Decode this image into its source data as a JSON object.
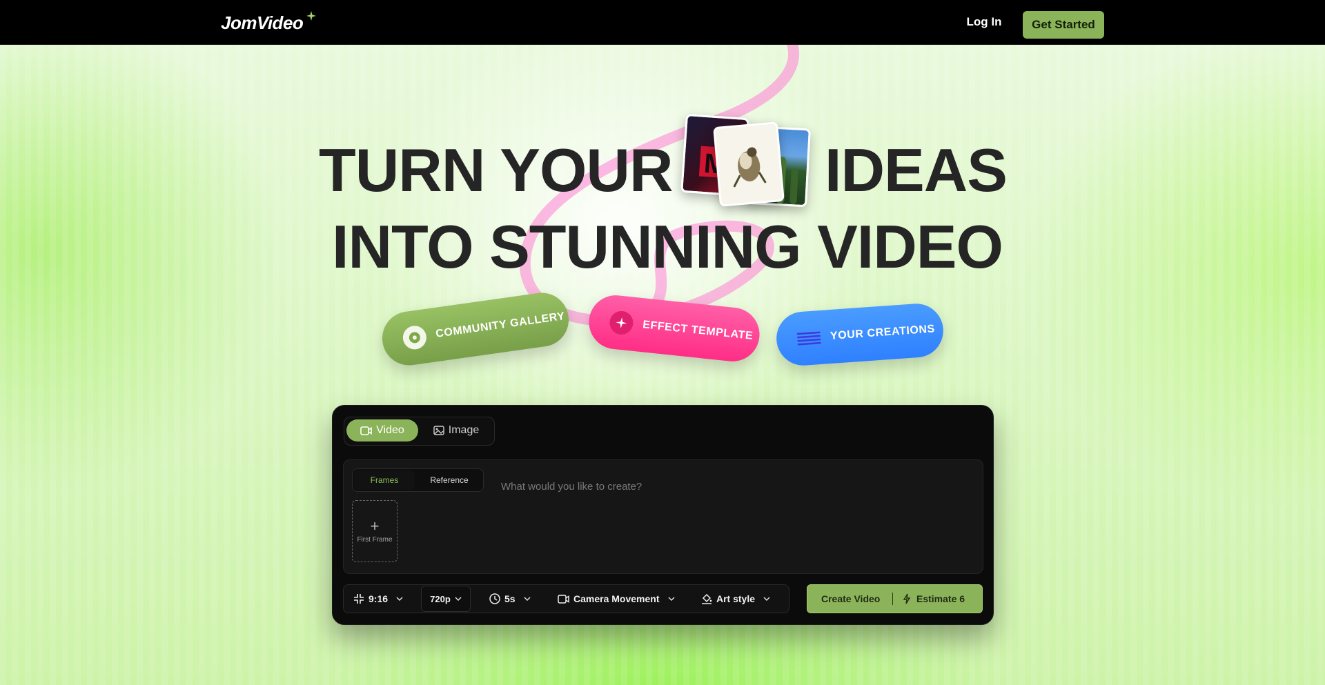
{
  "header": {
    "logo_text": "JomVideo",
    "login_label": "Log In",
    "get_started_label": "Get Started"
  },
  "hero": {
    "line1_left": "TURN YOUR",
    "line1_right": "IDEAS",
    "line2": "INTO STUNNING VIDEO"
  },
  "pills": {
    "community_gallery": "COMMUNITY GALLERY",
    "effect_template": "EFFECT TEMPLATE",
    "your_creations": "YOUR CREATIONS"
  },
  "creator": {
    "mode_tabs": {
      "video": "Video",
      "image": "Image",
      "active": "video"
    },
    "sub_tabs": {
      "frames": "Frames",
      "reference": "Reference",
      "active": "frames"
    },
    "prompt_placeholder": "What would you like to create?",
    "prompt_value": "",
    "first_frame_label": "First Frame",
    "options": {
      "aspect_ratio": "9:16",
      "resolution": "720p",
      "duration": "5s",
      "camera_movement": "Camera Movement",
      "art_style": "Art style"
    },
    "create_label": "Create Video",
    "estimate_label": "Estimate 6"
  },
  "colors": {
    "accent_green": "#8bb35a",
    "pink": "#ff2d86",
    "blue": "#2f80ff",
    "text_dark": "#252525"
  }
}
